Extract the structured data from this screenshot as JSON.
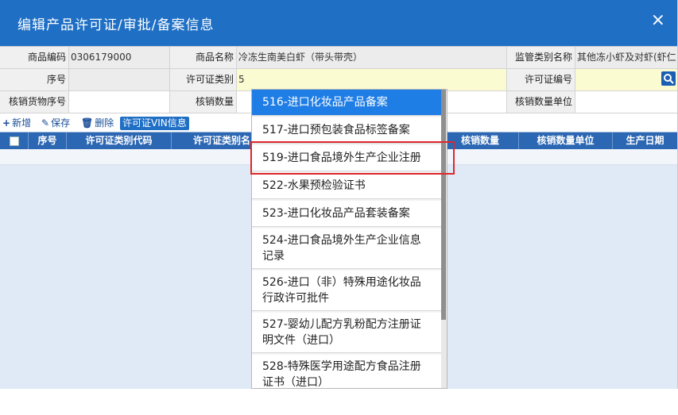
{
  "dialog": {
    "title": "编辑产品许可证/审批/备案信息",
    "close_icon": "close-icon",
    "close_glyph": "×"
  },
  "form": {
    "product_code_label": "商品编码",
    "product_code_value": "0306179000",
    "product_name_label": "商品名称",
    "product_name_value": "冷冻生南美白虾（带头带壳）",
    "supervision_label": "监管类别名称",
    "supervision_value": "其他冻小虾及对虾(虾仁",
    "seq_label": "序号",
    "seq_value": "",
    "license_type_label": "许可证类别",
    "license_type_value": "5",
    "license_no_label": "许可证编号",
    "license_no_value": "",
    "writeoff_seq_label": "核销货物序号",
    "writeoff_qty_label": "核销数量",
    "writeoff_unit_label": "核销数量单位"
  },
  "toolbar": {
    "add_label": "新增",
    "save_label": "保存",
    "delete_label": "删除",
    "vin_label": "许可证VIN信息"
  },
  "grid": {
    "columns": [
      "序号",
      "许可证类别代码",
      "许可证类别名",
      "核销数量",
      "核销数量单位",
      "生产日期"
    ]
  },
  "dropdown": {
    "options": [
      {
        "label": "516-进口化妆品产品备案",
        "lines": [
          "516-进口化妆品产品备案"
        ]
      },
      {
        "label": "517-进口预包装食品标签备案",
        "lines": [
          "517-进口预包装食品标签备案"
        ]
      },
      {
        "label": "519-进口食品境外生产企业注册",
        "lines": [
          "519-进口食品境外生产企业注册"
        ]
      },
      {
        "label": "522-水果预检验证书",
        "lines": [
          "522-水果预检验证书"
        ]
      },
      {
        "label": "523-进口化妆品产品套装备案",
        "lines": [
          "523-进口化妆品产品套装备案"
        ]
      },
      {
        "label": "524-进口食品境外生产企业信息记录",
        "lines": [
          "524-进口食品境外生产企业信息",
          "记录"
        ]
      },
      {
        "label": "526-进口（非）特殊用途化妆品行政许可批件",
        "lines": [
          "526-进口（非）特殊用途化妆品",
          "行政许可批件"
        ]
      },
      {
        "label": "527-婴幼儿配方乳粉配方注册证明文件（进口）",
        "lines": [
          "527-婴幼儿配方乳粉配方注册证",
          "明文件（进口）"
        ]
      },
      {
        "label": "528-特殊医学用途配方食品注册证书（进口）",
        "lines": [
          "528-特殊医学用途配方食品注册",
          "证书（进口）"
        ]
      }
    ],
    "active_index": 0,
    "highlighted_index": 2
  },
  "colors": {
    "titlebar": "#1f6fc5",
    "active_option": "#1f7de6",
    "highlight_border": "#e0262b"
  }
}
